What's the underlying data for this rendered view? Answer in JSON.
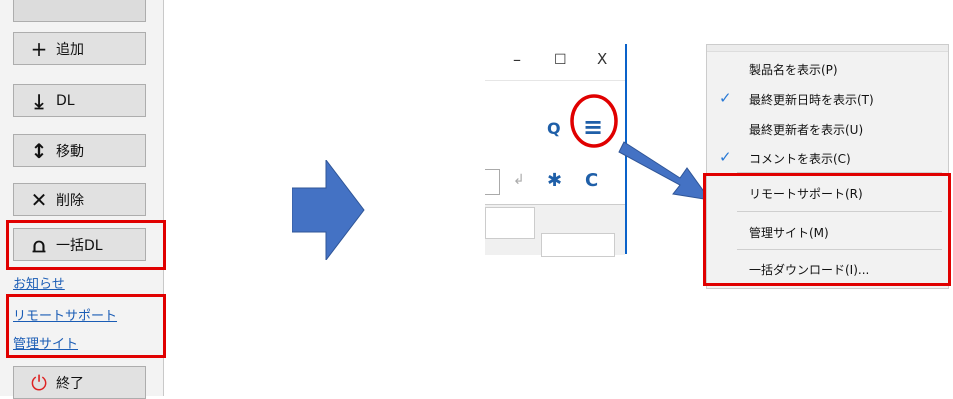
{
  "left_panel": {
    "buttons": [
      {
        "icon": "plus-icon",
        "glyph": "+",
        "label": "追加"
      },
      {
        "icon": "download-icon",
        "glyph": "⤓",
        "label": "DL"
      },
      {
        "icon": "move-icon",
        "glyph": "↕",
        "label": "移動"
      },
      {
        "icon": "delete-icon",
        "glyph": "✕",
        "label": "削除"
      },
      {
        "icon": "bulk-download-icon",
        "glyph": "⩍",
        "label": "一括DL"
      }
    ],
    "links": {
      "news": "お知らせ",
      "remote_support": "リモートサポート",
      "admin_site": "管理サイト"
    },
    "exit_button": {
      "icon": "power-icon",
      "glyph": "⏻",
      "label": "終了"
    }
  },
  "window": {
    "minimize": "–",
    "maximize": "☐",
    "close": "X",
    "search_glyph": "Q",
    "menu_glyph": "≡",
    "enter_glyph": "↲",
    "asterisk_glyph": "✱",
    "refresh_glyph": "C"
  },
  "menu": {
    "items": [
      {
        "label": "製品名を表示(P)",
        "checked": false
      },
      {
        "label": "最終更新日時を表示(T)",
        "checked": true
      },
      {
        "label": "最終更新者を表示(U)",
        "checked": false
      },
      {
        "label": "コメントを表示(C)",
        "checked": true
      },
      {
        "label": "リモートサポート(R)",
        "checked": false
      },
      {
        "label": "管理サイト(M)",
        "checked": false
      },
      {
        "label": "一括ダウンロード(I)...",
        "checked": false
      }
    ],
    "check_glyph": "✓"
  },
  "colors": {
    "highlight": "#e00000",
    "arrow": "#4472c4",
    "link": "#1a5cb5"
  }
}
